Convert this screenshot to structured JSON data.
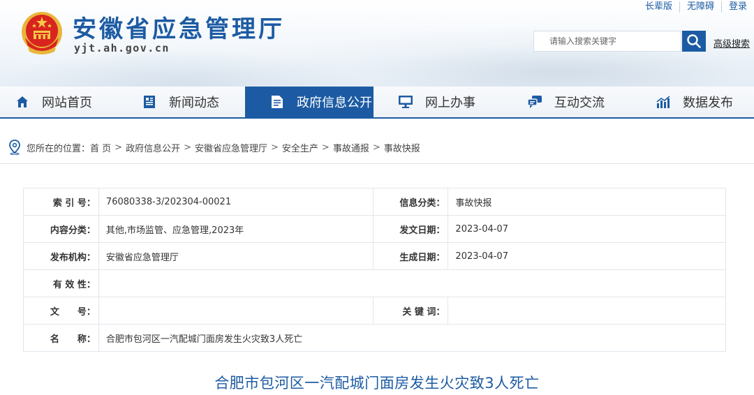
{
  "header": {
    "site_title": "安徽省应急管理厅",
    "site_domain": "yjt.ah.gov.cn",
    "top_links": [
      "长辈版",
      "无障碍",
      "登录"
    ],
    "search_placeholder": "请输入搜索关键字",
    "advanced_search": "高级搜索"
  },
  "nav": {
    "items": [
      {
        "label": "网站首页",
        "icon": "home-icon"
      },
      {
        "label": "新闻动态",
        "icon": "newspaper-icon"
      },
      {
        "label": "政府信息公开",
        "icon": "document-icon",
        "active": true
      },
      {
        "label": "网上办事",
        "icon": "monitor-icon"
      },
      {
        "label": "互动交流",
        "icon": "chat-icon"
      },
      {
        "label": "数据发布",
        "icon": "chart-icon"
      }
    ],
    "accent": "#1c5ba3"
  },
  "breadcrumb": {
    "prefix": "您所在的位置：",
    "items": [
      "首 页",
      "政府信息公开",
      "安徽省应急管理厅",
      "安全生产",
      "事故通报",
      "事故快报"
    ],
    "separator": ">"
  },
  "info": {
    "index_label": "索 引 号：",
    "index_value": "76080338-3/202304-00021",
    "category_label": "信息分类：",
    "category_value": "事故快报",
    "content_label": "内容分类：",
    "content_value": "其他,市场监管、应急管理,2023年",
    "issue_date_label": "发文日期：",
    "issue_date_value": "2023-04-07",
    "publisher_label": "发布机构：",
    "publisher_value": "安徽省应急管理厅",
    "generate_date_label": "生成日期：",
    "generate_date_value": "2023-04-07",
    "validity_label": "有 效 性：",
    "validity_value": "",
    "doc_no_label": "文　　号：",
    "doc_no_value": "",
    "keywords_label": "关 键 词：",
    "keywords_value": "",
    "name_label": "名　　称：",
    "name_value": "合肥市包河区一汽配城门面房发生火灾致3人死亡"
  },
  "article": {
    "title": "合肥市包河区一汽配城门面房发生火灾致3人死亡"
  }
}
